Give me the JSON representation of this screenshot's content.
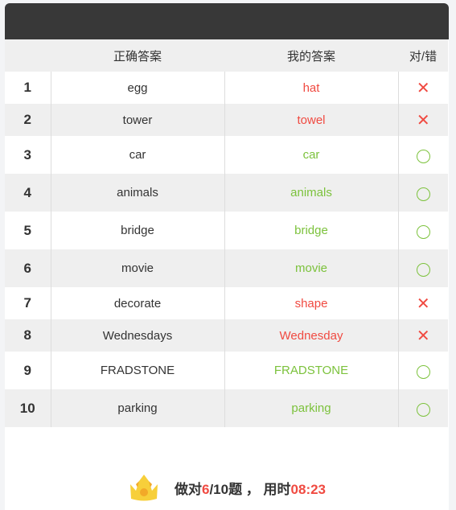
{
  "header": {
    "columns": [
      "",
      "正确答案",
      "我的答案",
      "对/错"
    ]
  },
  "rows": [
    {
      "n": "1",
      "correct": "egg",
      "mine": "hat",
      "ok": false
    },
    {
      "n": "2",
      "correct": "tower",
      "mine": "towel",
      "ok": false
    },
    {
      "n": "3",
      "correct": "car",
      "mine": "car",
      "ok": true
    },
    {
      "n": "4",
      "correct": "animals",
      "mine": "animals",
      "ok": true
    },
    {
      "n": "5",
      "correct": "bridge",
      "mine": "bridge",
      "ok": true
    },
    {
      "n": "6",
      "correct": "movie",
      "mine": "movie",
      "ok": true
    },
    {
      "n": "7",
      "correct": "decorate",
      "mine": "shape",
      "ok": false
    },
    {
      "n": "8",
      "correct": "Wednesdays",
      "mine": "Wednesday",
      "ok": false
    },
    {
      "n": "9",
      "correct": "FRADSTONE",
      "mine": "FRADSTONE",
      "ok": true
    },
    {
      "n": "10",
      "correct": "parking",
      "mine": "parking",
      "ok": true
    }
  ],
  "icons": {
    "wrong": "x-icon",
    "right": "circle-icon",
    "summary": "crown-icon"
  },
  "colors": {
    "wrong": "#f04a41",
    "right": "#7cc23c"
  },
  "summary": {
    "prefix": "做对",
    "correct": "6",
    "total_text": "/10题 ， 用时",
    "time": "08:23"
  }
}
